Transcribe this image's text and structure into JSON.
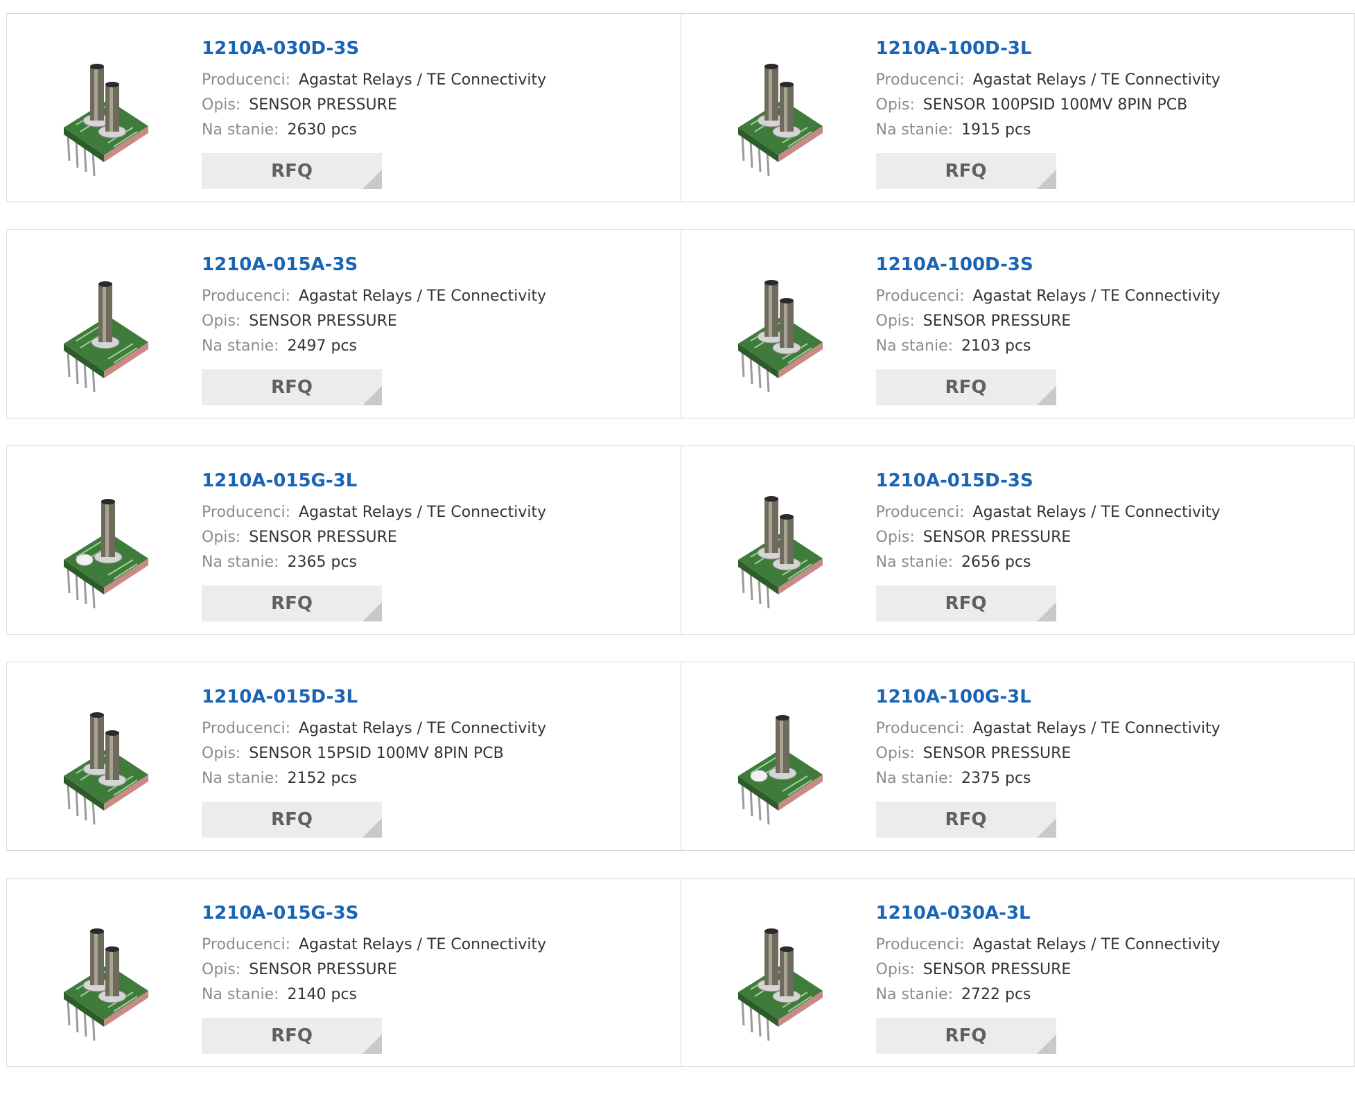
{
  "labels": {
    "manufacturer": "Producenci:",
    "description": "Opis:",
    "stock": "Na stanie:",
    "rfq": "RFQ"
  },
  "colors": {
    "title": "#1a64b4",
    "label": "#8c8c8c",
    "button_bg": "#ececec"
  },
  "products": [
    {
      "part": "1210A-030D-3S",
      "manufacturer": "Agastat Relays / TE Connectivity",
      "description": "SENSOR PRESSURE",
      "stock": "2630 pcs",
      "image": "pressure-sensor-dual-port-icon"
    },
    {
      "part": "1210A-100D-3L",
      "manufacturer": "Agastat Relays / TE Connectivity",
      "description": "SENSOR 100PSID 100MV 8PIN PCB",
      "stock": "1915 pcs",
      "image": "pressure-sensor-dual-port-icon"
    },
    {
      "part": "1210A-015A-3S",
      "manufacturer": "Agastat Relays / TE Connectivity",
      "description": "SENSOR PRESSURE",
      "stock": "2497 pcs",
      "image": "pressure-sensor-single-port-icon"
    },
    {
      "part": "1210A-100D-3S",
      "manufacturer": "Agastat Relays / TE Connectivity",
      "description": "SENSOR PRESSURE",
      "stock": "2103 pcs",
      "image": "pressure-sensor-dual-port-icon"
    },
    {
      "part": "1210A-015G-3L",
      "manufacturer": "Agastat Relays / TE Connectivity",
      "description": "SENSOR PRESSURE",
      "stock": "2365 pcs",
      "image": "pressure-sensor-gauge-icon"
    },
    {
      "part": "1210A-015D-3S",
      "manufacturer": "Agastat Relays / TE Connectivity",
      "description": "SENSOR PRESSURE",
      "stock": "2656 pcs",
      "image": "pressure-sensor-dual-port-icon"
    },
    {
      "part": "1210A-015D-3L",
      "manufacturer": "Agastat Relays / TE Connectivity",
      "description": "SENSOR 15PSID 100MV 8PIN PCB",
      "stock": "2152 pcs",
      "image": "pressure-sensor-dual-port-icon"
    },
    {
      "part": "1210A-100G-3L",
      "manufacturer": "Agastat Relays / TE Connectivity",
      "description": "SENSOR PRESSURE",
      "stock": "2375 pcs",
      "image": "pressure-sensor-gauge-icon"
    },
    {
      "part": "1210A-015G-3S",
      "manufacturer": "Agastat Relays / TE Connectivity",
      "description": "SENSOR PRESSURE",
      "stock": "2140 pcs",
      "image": "pressure-sensor-dual-port-icon"
    },
    {
      "part": "1210A-030A-3L",
      "manufacturer": "Agastat Relays / TE Connectivity",
      "description": "SENSOR PRESSURE",
      "stock": "2722 pcs",
      "image": "pressure-sensor-dual-port-icon"
    }
  ]
}
